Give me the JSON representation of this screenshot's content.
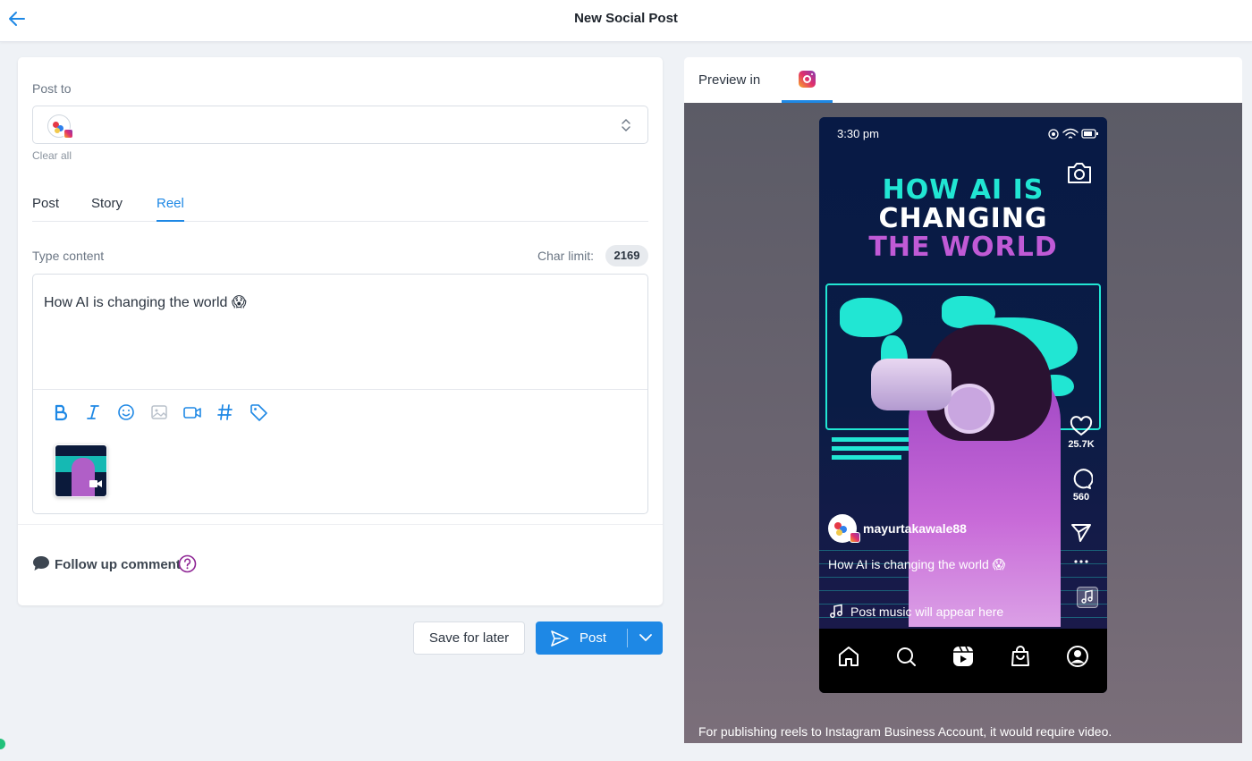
{
  "header": {
    "title": "New Social Post"
  },
  "compose": {
    "post_to_label": "Post to",
    "clear_all": "Clear all",
    "tabs": [
      {
        "label": "Post",
        "active": false
      },
      {
        "label": "Story",
        "active": false
      },
      {
        "label": "Reel",
        "active": true
      }
    ],
    "content_label": "Type content",
    "char_limit_label": "Char limit:",
    "char_limit_value": "2169",
    "content_text": "How AI is changing the world 😱",
    "toolbar": [
      "bold-icon",
      "italic-icon",
      "emoji-icon",
      "image-icon",
      "video-icon",
      "hashtag-icon",
      "tag-icon"
    ],
    "follow_up_label": "Follow up comment"
  },
  "actions": {
    "save_later": "Save for later",
    "post": "Post"
  },
  "preview": {
    "label": "Preview in",
    "note": "For publishing reels to Instagram Business Account, it would require video.",
    "phone": {
      "time": "3:30 pm",
      "headline": [
        "HOW AI IS",
        "CHANGING",
        "THE WORLD"
      ],
      "likes": "25.7K",
      "comments": "560",
      "username": "mayurtakawale88",
      "caption": "How AI is changing the world 😱",
      "music": "Post music will appear here"
    }
  },
  "colors": {
    "accent": "#1e88e5",
    "cyan": "#21e6d3",
    "purple": "#c05ad6"
  }
}
